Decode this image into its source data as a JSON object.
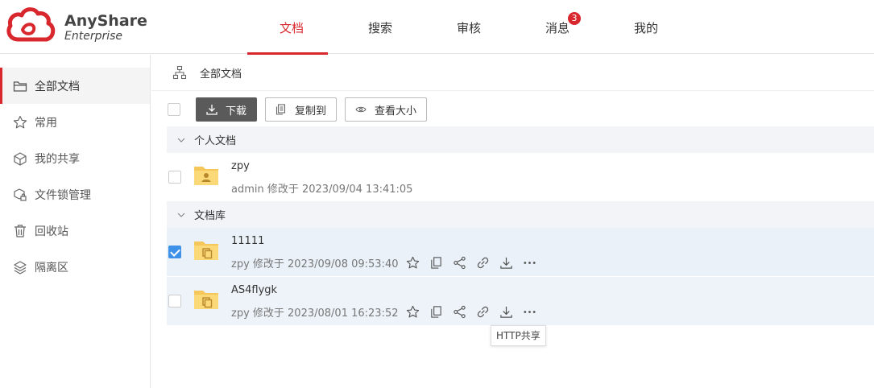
{
  "brand": {
    "name": "AnyShare",
    "sub": "Enterprise",
    "color": "#d9272e",
    "icon": "cloud-logo-icon"
  },
  "nav": {
    "tabs": [
      {
        "label": "文档",
        "active": true
      },
      {
        "label": "搜索",
        "active": false
      },
      {
        "label": "审核",
        "active": false
      },
      {
        "label": "消息",
        "active": false
      },
      {
        "label": "我的",
        "active": false
      }
    ],
    "message_badge": "3"
  },
  "sidebar": {
    "items": [
      {
        "label": "全部文档",
        "icon": "folder-icon",
        "active": true
      },
      {
        "label": "常用",
        "icon": "star-icon",
        "active": false
      },
      {
        "label": "我的共享",
        "icon": "share-box-icon",
        "active": false
      },
      {
        "label": "文件锁管理",
        "icon": "file-lock-icon",
        "active": false
      },
      {
        "label": "回收站",
        "icon": "trash-icon",
        "active": false
      },
      {
        "label": "隔离区",
        "icon": "layers-icon",
        "active": false
      }
    ]
  },
  "breadcrumb": {
    "icon": "sitemap-icon",
    "text": "全部文档"
  },
  "toolbar": {
    "download": "下载",
    "copy_to": "复制到",
    "view_size": "查看大小"
  },
  "groups": [
    {
      "label": "个人文档",
      "rows": [
        {
          "name": "zpy",
          "meta": "admin 修改于 2023/09/04 13:41:05",
          "checked": false,
          "folder": "personal-folder-icon"
        }
      ]
    },
    {
      "label": "文档库",
      "rows": [
        {
          "name": "11111",
          "meta": "zpy 修改于 2023/09/08 09:53:40",
          "checked": true,
          "folder": "library-folder-icon"
        },
        {
          "name": "AS4flygk",
          "meta": "zpy 修改于 2023/08/01 16:23:52",
          "checked": false,
          "folder": "library-folder-icon"
        }
      ]
    }
  ],
  "row_actions": [
    "star-icon",
    "copy-icon",
    "share-icon",
    "link-icon",
    "download-icon",
    "more-icon"
  ],
  "tooltip": "HTTP共享",
  "colors": {
    "accent": "#d9272e",
    "check": "#3d91e8",
    "folder": "#f5c75b",
    "selected_row": "#eaf1f9"
  }
}
